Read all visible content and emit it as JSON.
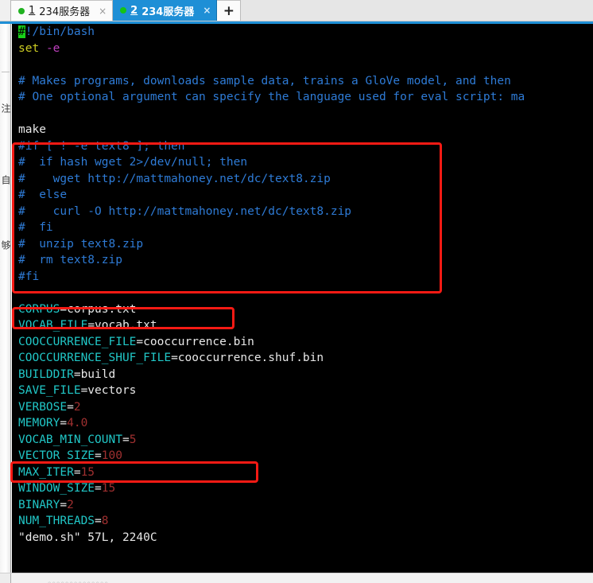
{
  "window": {
    "accent_color": "#1e8fd6"
  },
  "tabbar": {
    "tabs": [
      {
        "num": "1",
        "label": " 234服务器",
        "close": "×",
        "dot": "green-status-dot",
        "active": false
      },
      {
        "num": "2",
        "label": " 234服务器",
        "close": "×",
        "dot": "green-status-dot",
        "active": true
      }
    ],
    "add_label": "+"
  },
  "sidebar": {
    "clipped_labels": [
      "注",
      "自",
      "够"
    ]
  },
  "terminal": {
    "background": "#000000",
    "lines": [
      [
        {
          "t": "#",
          "c": "cursor"
        },
        {
          "t": "!/bin/bash",
          "c": "blue"
        }
      ],
      [
        {
          "t": "set",
          "c": "yellow"
        },
        {
          "t": " ",
          "c": "white"
        },
        {
          "t": "-e",
          "c": "purple"
        }
      ],
      [
        {
          "t": "",
          "c": "white"
        }
      ],
      [
        {
          "t": "# Makes programs, downloads sample data, trains a GloVe model, and then",
          "c": "blue"
        }
      ],
      [
        {
          "t": "# One optional argument can specify the language used for eval script: ma",
          "c": "blue"
        }
      ],
      [
        {
          "t": "",
          "c": "white"
        }
      ],
      [
        {
          "t": "make",
          "c": "white"
        }
      ],
      [
        {
          "t": "#if [ ! -e text8 ]; then",
          "c": "blue"
        }
      ],
      [
        {
          "t": "#  if hash wget 2>/dev/null; then",
          "c": "blue"
        }
      ],
      [
        {
          "t": "#    wget http://mattmahoney.net/dc/text8.zip",
          "c": "blue"
        }
      ],
      [
        {
          "t": "#  else",
          "c": "blue"
        }
      ],
      [
        {
          "t": "#    curl -O http://mattmahoney.net/dc/text8.zip",
          "c": "blue"
        }
      ],
      [
        {
          "t": "#  fi",
          "c": "blue"
        }
      ],
      [
        {
          "t": "#  unzip text8.zip",
          "c": "blue"
        }
      ],
      [
        {
          "t": "#  rm text8.zip",
          "c": "blue"
        }
      ],
      [
        {
          "t": "#fi",
          "c": "blue"
        }
      ],
      [
        {
          "t": "",
          "c": "white"
        }
      ],
      [
        {
          "t": "CORPUS",
          "c": "cyan"
        },
        {
          "t": "=corpus.txt",
          "c": "white"
        }
      ],
      [
        {
          "t": "VOCAB_FILE",
          "c": "cyan"
        },
        {
          "t": "=vocab.txt",
          "c": "white"
        }
      ],
      [
        {
          "t": "COOCCURRENCE_FILE",
          "c": "cyan"
        },
        {
          "t": "=cooccurrence.bin",
          "c": "white"
        }
      ],
      [
        {
          "t": "COOCCURRENCE_SHUF_FILE",
          "c": "cyan"
        },
        {
          "t": "=cooccurrence.shuf.bin",
          "c": "white"
        }
      ],
      [
        {
          "t": "BUILDDIR",
          "c": "cyan"
        },
        {
          "t": "=build",
          "c": "white"
        }
      ],
      [
        {
          "t": "SAVE_FILE",
          "c": "cyan"
        },
        {
          "t": "=vectors",
          "c": "white"
        }
      ],
      [
        {
          "t": "VERBOSE",
          "c": "cyan"
        },
        {
          "t": "=",
          "c": "white"
        },
        {
          "t": "2",
          "c": "red"
        }
      ],
      [
        {
          "t": "MEMORY",
          "c": "cyan"
        },
        {
          "t": "=",
          "c": "white"
        },
        {
          "t": "4.0",
          "c": "red"
        }
      ],
      [
        {
          "t": "VOCAB_MIN_COUNT",
          "c": "cyan"
        },
        {
          "t": "=",
          "c": "white"
        },
        {
          "t": "5",
          "c": "red"
        }
      ],
      [
        {
          "t": "VECTOR_SIZE",
          "c": "cyan"
        },
        {
          "t": "=",
          "c": "white"
        },
        {
          "t": "100",
          "c": "red"
        }
      ],
      [
        {
          "t": "MAX_ITER",
          "c": "cyan"
        },
        {
          "t": "=",
          "c": "white"
        },
        {
          "t": "15",
          "c": "red"
        }
      ],
      [
        {
          "t": "WINDOW_SIZE",
          "c": "cyan"
        },
        {
          "t": "=",
          "c": "white"
        },
        {
          "t": "15",
          "c": "red"
        }
      ],
      [
        {
          "t": "BINARY",
          "c": "cyan"
        },
        {
          "t": "=",
          "c": "white"
        },
        {
          "t": "2",
          "c": "red"
        }
      ],
      [
        {
          "t": "NUM_THREADS",
          "c": "cyan"
        },
        {
          "t": "=",
          "c": "white"
        },
        {
          "t": "8",
          "c": "red"
        }
      ],
      [
        {
          "t": "\"demo.sh\" 57L, 2240C",
          "c": "white"
        }
      ]
    ]
  },
  "annotations": {
    "color": "#f61a14",
    "boxes": [
      {
        "name": "commented-download-block",
        "target": "#if [ ! -e text8 ]; then ... #fi"
      },
      {
        "name": "corpus-assignment",
        "target": "CORPUS=corpus.txt"
      },
      {
        "name": "vector-size-assignment",
        "target": "VECTOR_SIZE=100"
      }
    ]
  },
  "statusbar": {
    "text": "。。。。。。。。。。。。。。"
  }
}
